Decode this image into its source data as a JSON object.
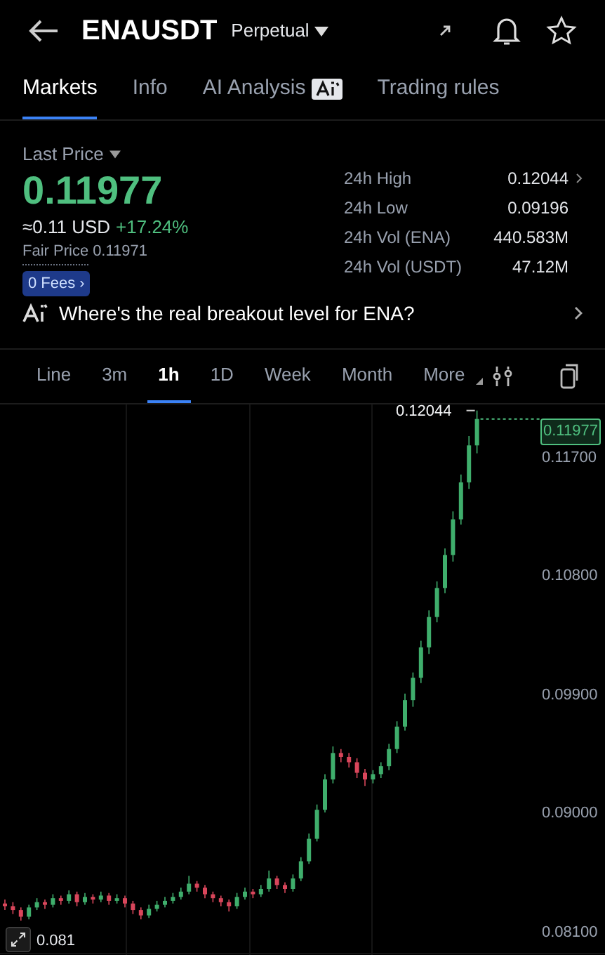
{
  "header": {
    "symbol": "ENAUSDT",
    "contract": "Perpetual"
  },
  "tabs": [
    {
      "label": "Markets",
      "selected": true,
      "ai_badge": false
    },
    {
      "label": "Info",
      "selected": false,
      "ai_badge": false
    },
    {
      "label": "AI Analysis",
      "selected": false,
      "ai_badge": true
    },
    {
      "label": "Trading rules",
      "selected": false,
      "ai_badge": false
    }
  ],
  "price": {
    "label": "Last Price",
    "value": "0.11977",
    "usd": "≈0.11 USD",
    "change": "+17.24%",
    "fair_label": "Fair Price",
    "fair_value": "0.11971",
    "fees": "0 Fees ›"
  },
  "stats": [
    {
      "label": "24h High",
      "value": "0.12044",
      "link": true
    },
    {
      "label": "24h Low",
      "value": "0.09196",
      "link": false
    },
    {
      "label": "24h Vol (ENA)",
      "value": "440.583M",
      "link": false
    },
    {
      "label": "24h Vol (USDT)",
      "value": "47.12M",
      "link": false
    }
  ],
  "ai_prompt": "Where's the real breakout level for ENA?",
  "intervals": [
    {
      "label": "Line",
      "selected": false
    },
    {
      "label": "3m",
      "selected": false
    },
    {
      "label": "1h",
      "selected": true
    },
    {
      "label": "1D",
      "selected": false
    },
    {
      "label": "Week",
      "selected": false
    },
    {
      "label": "Month",
      "selected": false
    },
    {
      "label": "More",
      "selected": false
    }
  ],
  "chart": {
    "high_marker": "0.12044",
    "current_price": "0.11977",
    "low_marker": "0.081",
    "chart_data": {
      "type": "candlestick",
      "ylim": [
        0.0792,
        0.1209
      ],
      "ohlc": [
        [
          0.0831,
          0.0834,
          0.0826,
          0.0829
        ],
        [
          0.0829,
          0.0832,
          0.0823,
          0.0826
        ],
        [
          0.0826,
          0.0828,
          0.0818,
          0.0821
        ],
        [
          0.0821,
          0.083,
          0.0819,
          0.0828
        ],
        [
          0.0828,
          0.0835,
          0.0826,
          0.0832
        ],
        [
          0.0832,
          0.0834,
          0.0827,
          0.083
        ],
        [
          0.083,
          0.0838,
          0.0828,
          0.0835
        ],
        [
          0.0835,
          0.0837,
          0.083,
          0.0833
        ],
        [
          0.0833,
          0.0841,
          0.0831,
          0.0838
        ],
        [
          0.0838,
          0.084,
          0.0829,
          0.0832
        ],
        [
          0.0832,
          0.0839,
          0.083,
          0.0836
        ],
        [
          0.0836,
          0.0838,
          0.0831,
          0.0834
        ],
        [
          0.0834,
          0.084,
          0.0832,
          0.0837
        ],
        [
          0.0837,
          0.0839,
          0.083,
          0.0833
        ],
        [
          0.0833,
          0.0838,
          0.0831,
          0.0835
        ],
        [
          0.0835,
          0.0837,
          0.0828,
          0.0831
        ],
        [
          0.0831,
          0.0833,
          0.0823,
          0.0826
        ],
        [
          0.0826,
          0.0828,
          0.0819,
          0.0822
        ],
        [
          0.0822,
          0.083,
          0.082,
          0.0827
        ],
        [
          0.0827,
          0.0833,
          0.0825,
          0.083
        ],
        [
          0.083,
          0.0836,
          0.0828,
          0.0833
        ],
        [
          0.0833,
          0.0839,
          0.0831,
          0.0836
        ],
        [
          0.0836,
          0.0843,
          0.0834,
          0.084
        ],
        [
          0.084,
          0.0852,
          0.0838,
          0.0846
        ],
        [
          0.0846,
          0.0848,
          0.084,
          0.0843
        ],
        [
          0.0843,
          0.0845,
          0.0835,
          0.0838
        ],
        [
          0.0838,
          0.084,
          0.0832,
          0.0835
        ],
        [
          0.0835,
          0.0837,
          0.0829,
          0.0832
        ],
        [
          0.0832,
          0.0834,
          0.0825,
          0.0829
        ],
        [
          0.0829,
          0.0839,
          0.0827,
          0.0836
        ],
        [
          0.0836,
          0.0843,
          0.0834,
          0.084
        ],
        [
          0.084,
          0.0842,
          0.0835,
          0.0838
        ],
        [
          0.0838,
          0.0845,
          0.0836,
          0.0842
        ],
        [
          0.0842,
          0.0856,
          0.084,
          0.085
        ],
        [
          0.085,
          0.0852,
          0.0842,
          0.0845
        ],
        [
          0.0845,
          0.0847,
          0.0839,
          0.0842
        ],
        [
          0.0842,
          0.0853,
          0.084,
          0.085
        ],
        [
          0.085,
          0.0866,
          0.0848,
          0.0863
        ],
        [
          0.0863,
          0.0884,
          0.0861,
          0.088
        ],
        [
          0.088,
          0.0906,
          0.0878,
          0.0902
        ],
        [
          0.0902,
          0.0929,
          0.09,
          0.0925
        ],
        [
          0.0925,
          0.095,
          0.0922,
          0.0945
        ],
        [
          0.0945,
          0.0948,
          0.0938,
          0.0942
        ],
        [
          0.0942,
          0.0945,
          0.0934,
          0.0938
        ],
        [
          0.0938,
          0.0941,
          0.0926,
          0.093
        ],
        [
          0.093,
          0.0933,
          0.092,
          0.0925
        ],
        [
          0.0925,
          0.0932,
          0.0922,
          0.0929
        ],
        [
          0.0929,
          0.0938,
          0.0926,
          0.0935
        ],
        [
          0.0935,
          0.0952,
          0.0932,
          0.0948
        ],
        [
          0.0948,
          0.0969,
          0.0945,
          0.0965
        ],
        [
          0.0965,
          0.099,
          0.0962,
          0.0985
        ],
        [
          0.0985,
          0.1006,
          0.098,
          0.1002
        ],
        [
          0.1002,
          0.103,
          0.0998,
          0.1025
        ],
        [
          0.1025,
          0.1053,
          0.102,
          0.1048
        ],
        [
          0.1048,
          0.1075,
          0.1044,
          0.107
        ],
        [
          0.107,
          0.11,
          0.1066,
          0.1095
        ],
        [
          0.1095,
          0.1128,
          0.109,
          0.1122
        ],
        [
          0.1122,
          0.1156,
          0.1118,
          0.115
        ],
        [
          0.115,
          0.1185,
          0.1145,
          0.1178
        ],
        [
          0.1178,
          0.12044,
          0.1172,
          0.1198
        ]
      ],
      "yticks": [
        {
          "value": 0.117,
          "label": "0.11700"
        },
        {
          "value": 0.108,
          "label": "0.10800"
        },
        {
          "value": 0.099,
          "label": "0.09900"
        },
        {
          "value": 0.09,
          "label": "0.09000"
        },
        {
          "value": 0.081,
          "label": "0.08100"
        }
      ]
    }
  }
}
